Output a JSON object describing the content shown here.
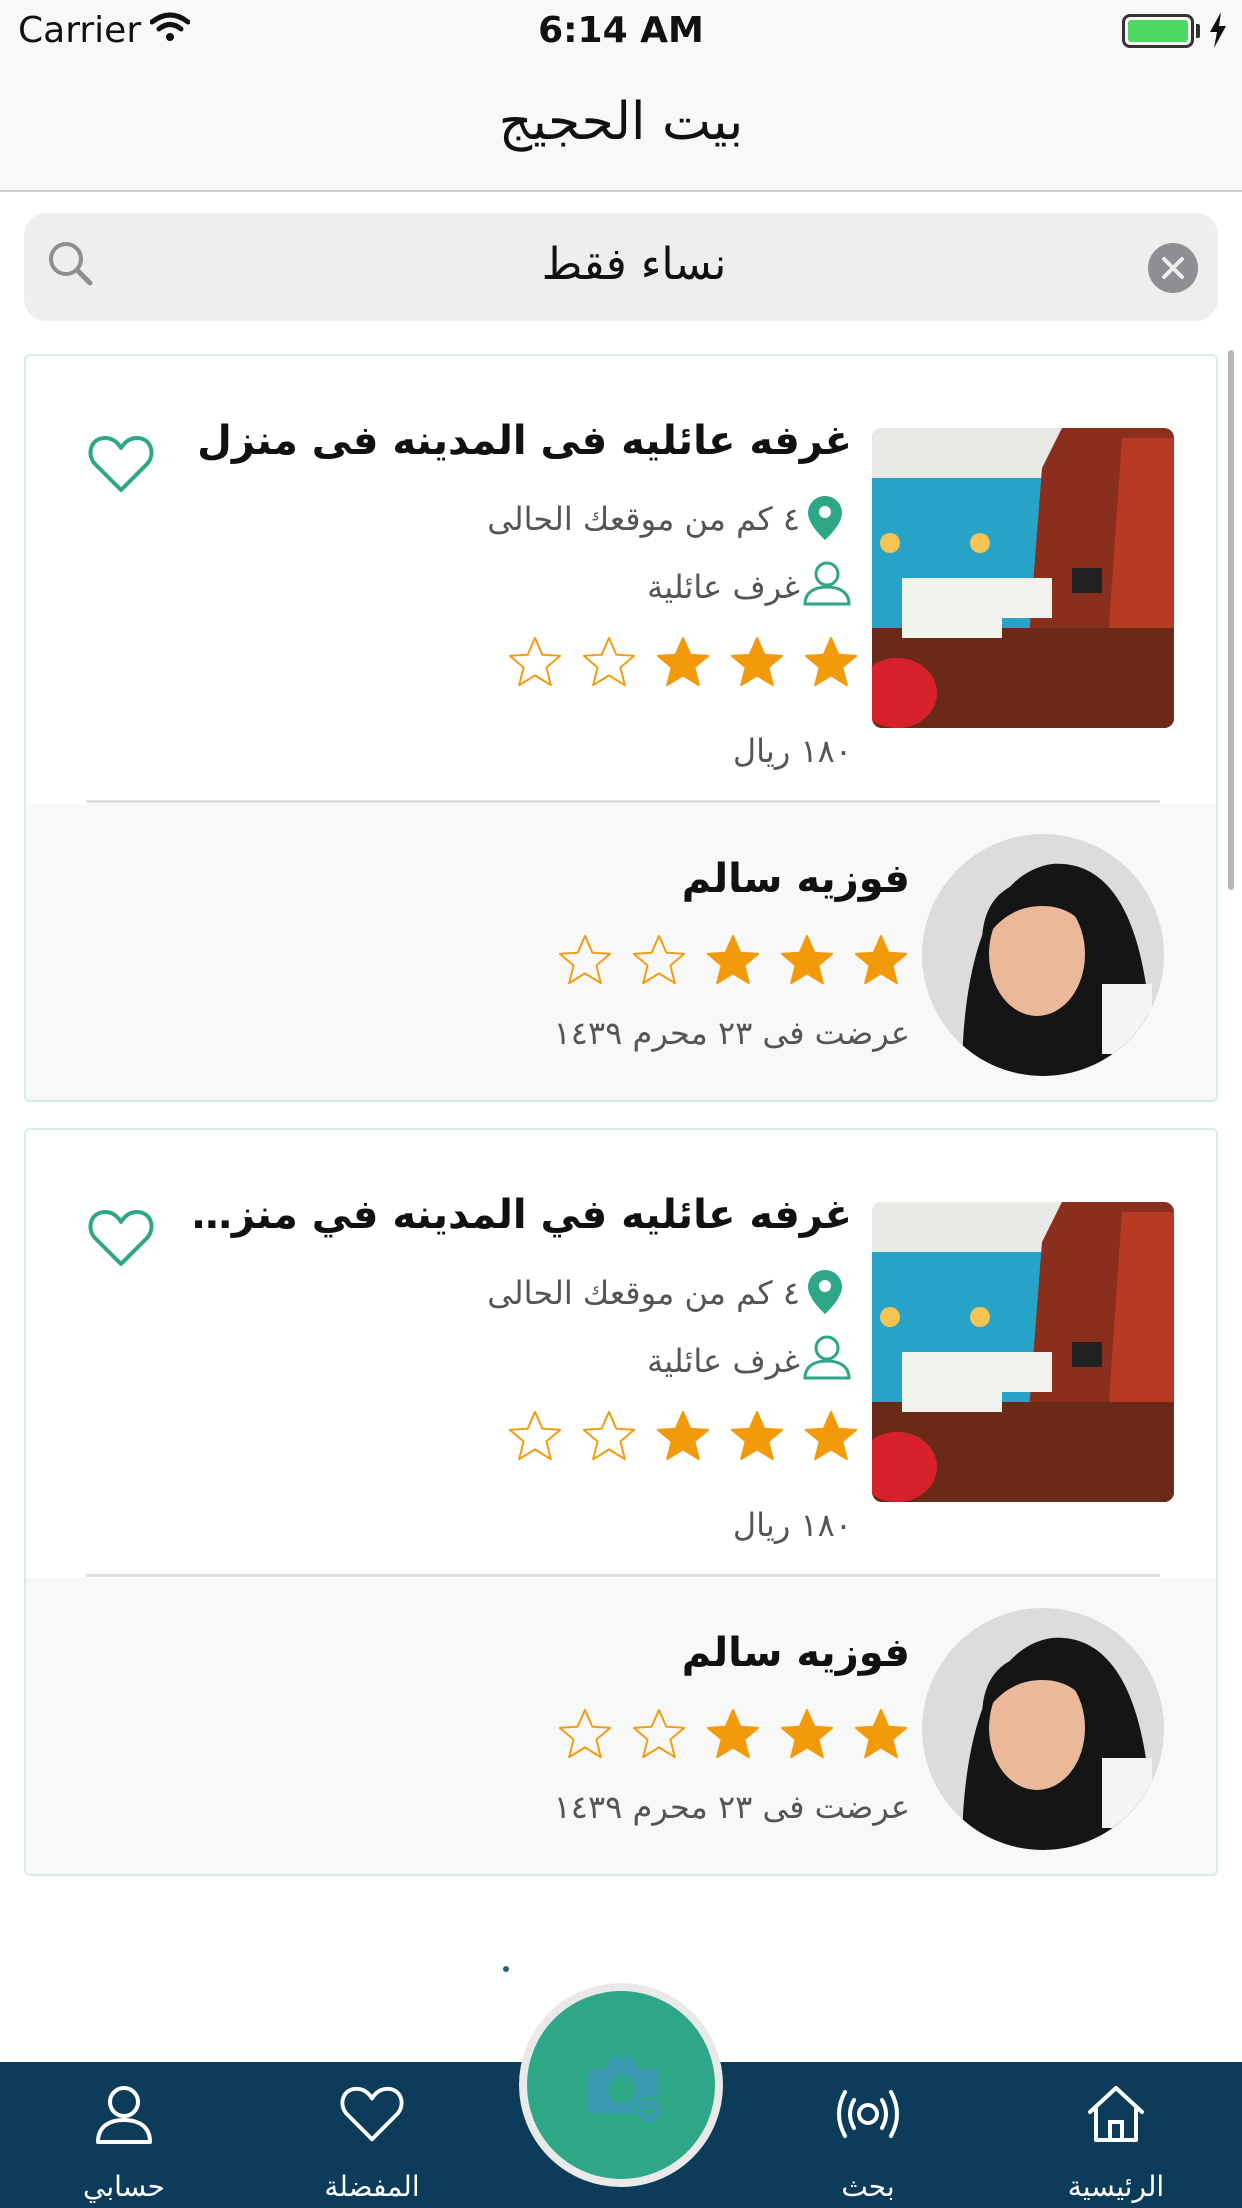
{
  "status_bar": {
    "carrier": "Carrier",
    "time": "6:14 AM",
    "battery_level": 1.0
  },
  "nav": {
    "title": "بيت الحجيج"
  },
  "search": {
    "query": "نساء فقط"
  },
  "listings": [
    {
      "title": "غرفه عائليه فى المدينه فى منزل",
      "distance": "٤ كم من موقعك الحالى",
      "category": "غرف عائلية",
      "rating": 3,
      "max_rating": 5,
      "price": "١٨٠ ريال",
      "host": {
        "name": "فوزيه سالم",
        "rating": 3,
        "posted": "عرضت فى ٢٣ محرم ١٤٣٩"
      }
    },
    {
      "title": "غرفه عائليه في المدينه في منزل قريب...",
      "distance": "٤ كم من موقعك الحالى",
      "category": "غرف عائلية",
      "rating": 3,
      "max_rating": 5,
      "price": "١٨٠ ريال",
      "host": {
        "name": "فوزيه سالم",
        "rating": 3,
        "posted": "عرضت فى ٢٣ محرم ١٤٣٩"
      }
    }
  ],
  "tabs": {
    "home": "الرئيسية",
    "search": "بحث",
    "favorites": "المفضلة",
    "account": "حسابي"
  },
  "icons": {
    "search": "search-icon",
    "clear": "clear-icon",
    "heart": "heart-icon",
    "pin": "location-pin-icon",
    "person": "person-icon",
    "star": "star-icon",
    "home": "home-icon",
    "broadcast": "broadcast-icon",
    "camera": "camera-icon"
  },
  "colors": {
    "accent": "#2da785",
    "star": "#f39a0b",
    "tab_bar": "#0d3b5a"
  }
}
